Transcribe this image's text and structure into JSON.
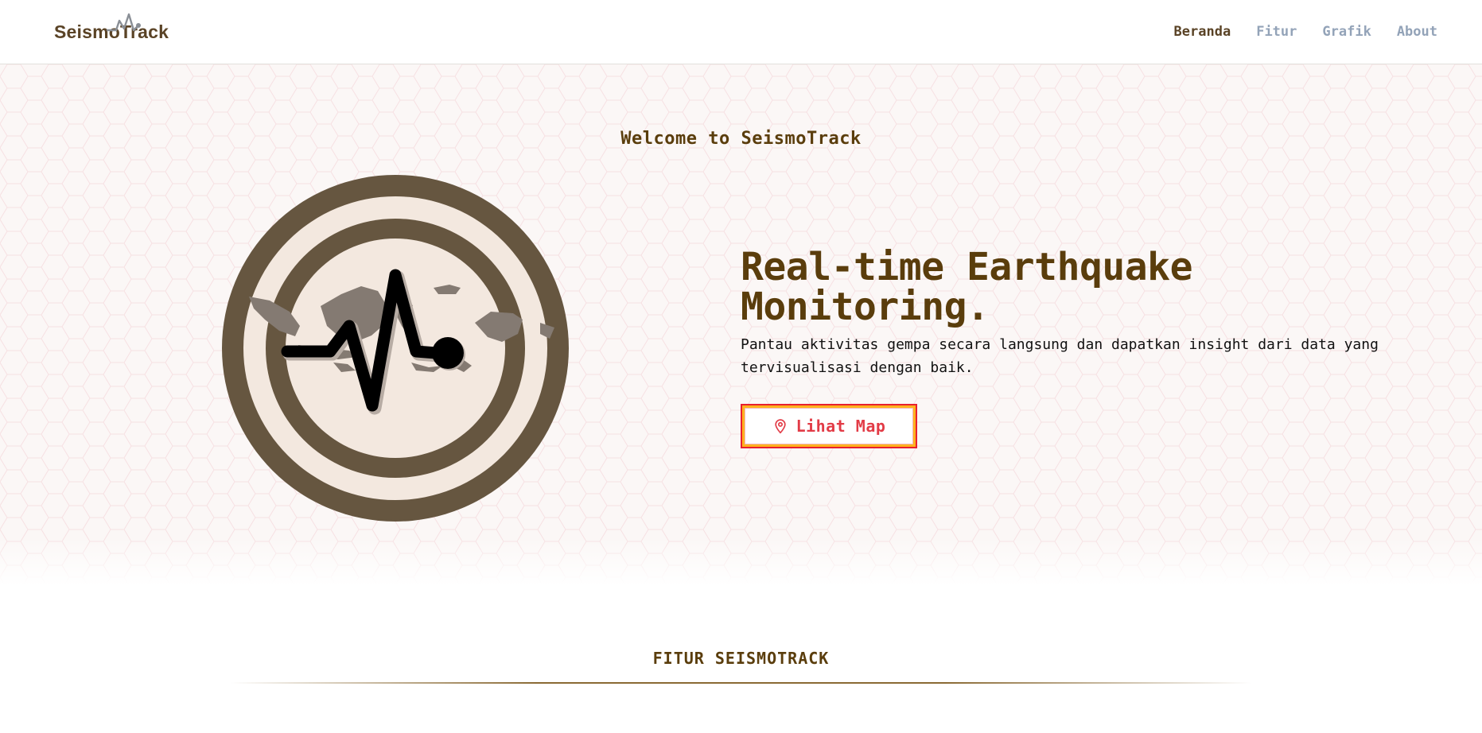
{
  "brand": {
    "name": "SeismoTrack",
    "logo_icon": "seismic-wave-icon"
  },
  "nav": {
    "items": [
      {
        "label": "Beranda",
        "active": true
      },
      {
        "label": "Fitur",
        "active": false
      },
      {
        "label": "Grafik",
        "active": false
      },
      {
        "label": "About",
        "active": false
      }
    ]
  },
  "hero": {
    "welcome": "Welcome to SeismoTrack",
    "title": "Real-time Earthquake Monitoring.",
    "description": "Pantau aktivitas gempa secara langsung dan dapatkan insight dari data yang tervisualisasi dengan baik.",
    "cta": {
      "label": "Lihat Map",
      "icon": "map-pin-icon"
    }
  },
  "features": {
    "title": "FITUR SEISMOTRACK"
  },
  "colors": {
    "brand_brown": "#5a3d0c",
    "ring_brown": "#665640",
    "nav_inactive": "#93a3b8",
    "cta_red": "#e23b46",
    "cta_orange": "#ffb21e"
  }
}
